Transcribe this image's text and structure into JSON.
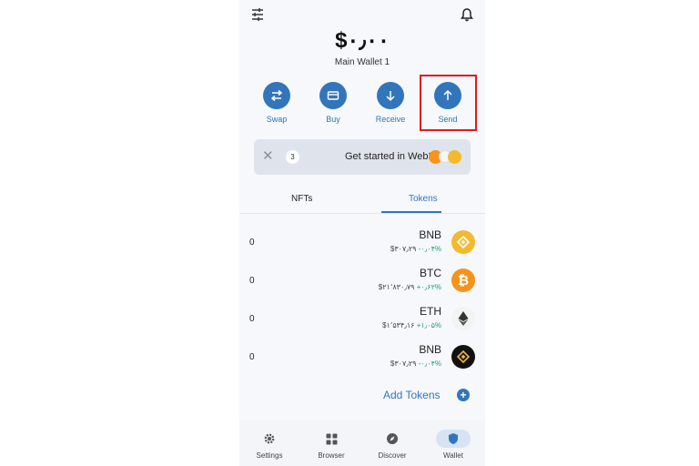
{
  "header": {
    "filter_icon": "sliders-icon",
    "bell_icon": "bell-icon"
  },
  "balance": "$۰٫۰۰",
  "wallet_name": "Main Wallet 1",
  "actions": [
    {
      "label": "Swap",
      "icon": "swap-icon"
    },
    {
      "label": "Buy",
      "icon": "card-icon"
    },
    {
      "label": "Receive",
      "icon": "arrow-down-icon"
    },
    {
      "label": "Send",
      "icon": "arrow-up-icon"
    }
  ],
  "banner": {
    "count": "3",
    "text": "Get started in Web3"
  },
  "tabs": [
    {
      "label": "NFTs"
    },
    {
      "label": "Tokens",
      "active": true
    }
  ],
  "tokens": [
    {
      "balance": "0",
      "symbol": "BNB",
      "price": "$۳۰۷٫۲۹",
      "change": "-۰٫۰۴%",
      "color": "#f3ba2f"
    },
    {
      "balance": "0",
      "symbol": "BTC",
      "price": "$۲۱٬۸۳۰٫۷۹",
      "change": "+۰٫۶۲%",
      "color": "#f7931a"
    },
    {
      "balance": "0",
      "symbol": "ETH",
      "price": "$۱٬۵۳۴٫۱۶",
      "change": "+۱٫۰۵%",
      "color": "#f3f3f3"
    },
    {
      "balance": "0",
      "symbol": "BNB",
      "price": "$۳۰۷٫۲۹",
      "change": "-۰٫۰۴%",
      "color": "#111111"
    }
  ],
  "add_tokens": "Add Tokens",
  "nav": [
    {
      "label": "Settings",
      "icon": "gear-icon"
    },
    {
      "label": "Browser",
      "icon": "grid-icon"
    },
    {
      "label": "Discover",
      "icon": "compass-icon"
    },
    {
      "label": "Wallet",
      "icon": "shield-icon",
      "active": true
    }
  ],
  "colors": {
    "accent": "#3275bb",
    "highlight": "#e01b1b"
  }
}
